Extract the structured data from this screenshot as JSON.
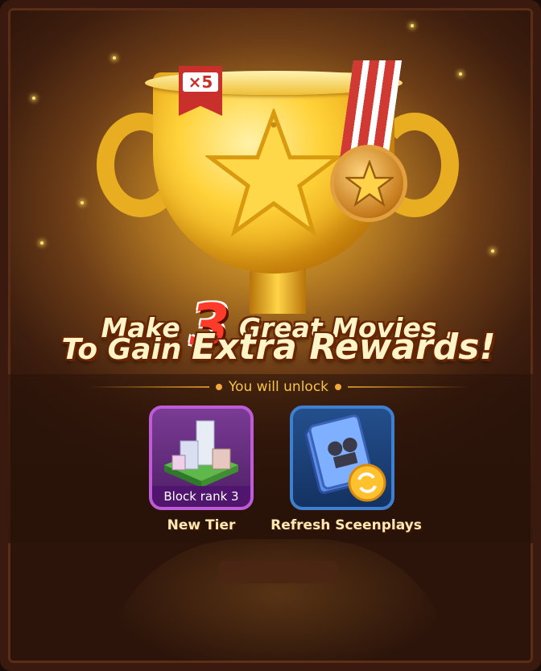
{
  "trophy": {
    "multiplier_badge": "×5"
  },
  "headline": {
    "line1_before": "Make",
    "line1_number": "3",
    "line1_after": "Great Movies ,",
    "line2_before": "To Gain",
    "line2_emphasis": "Extra Rewards!"
  },
  "unlock": {
    "heading": "You will unlock",
    "items": [
      {
        "label": "New Tier",
        "caption": "Block rank 3",
        "icon": "city-block-icon"
      },
      {
        "label": "Refresh Sceenplays",
        "icon": "screenplay-refresh-icon"
      }
    ]
  },
  "colors": {
    "accent_gold": "#f6c34a",
    "purple_card": "#c05bd8",
    "blue_card": "#3f7fd0",
    "headline_red": "#ff3b2a"
  }
}
